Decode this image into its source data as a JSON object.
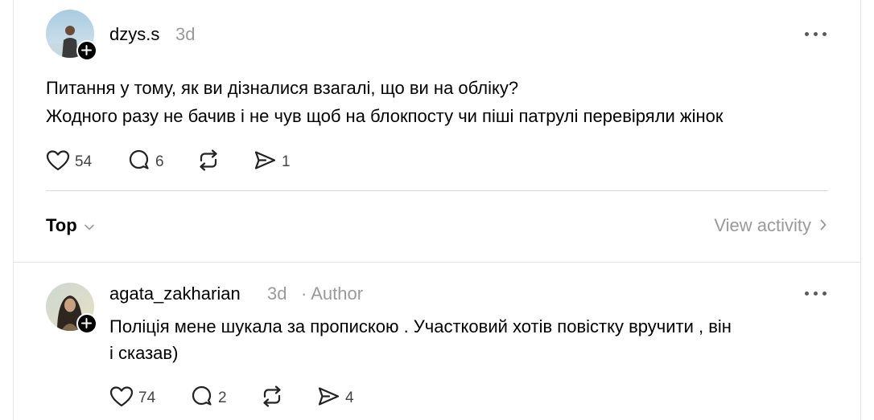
{
  "post": {
    "username": "dzys.s",
    "time": "3d",
    "text_lines": [
      "Питання у тому, як ви дізналися взагалі, що ви на обліку?",
      "Жодного разу не бачив і не чув щоб на блокпосту чи піші патрулі перевіряли жінок"
    ],
    "likes": "54",
    "replies": "6",
    "shares": "1"
  },
  "sort": {
    "label": "Top",
    "view_activity": "View activity"
  },
  "reply": {
    "username": "agata_zakharian",
    "time": "3d",
    "badge": "· Author",
    "text_lines": [
      "Поліція мене шукала за пропискою . Участковий хотів повістку вручити , він",
      "і сказав)"
    ],
    "likes": "74",
    "replies": "2",
    "shares": "4"
  },
  "icons": {
    "like": "heart-icon",
    "reply": "comment-icon",
    "repost": "repost-icon",
    "share": "send-icon",
    "more": "more-horizontal-icon",
    "follow": "plus-icon",
    "chevron_down": "chevron-down-icon",
    "chevron_right": "chevron-right-icon"
  }
}
